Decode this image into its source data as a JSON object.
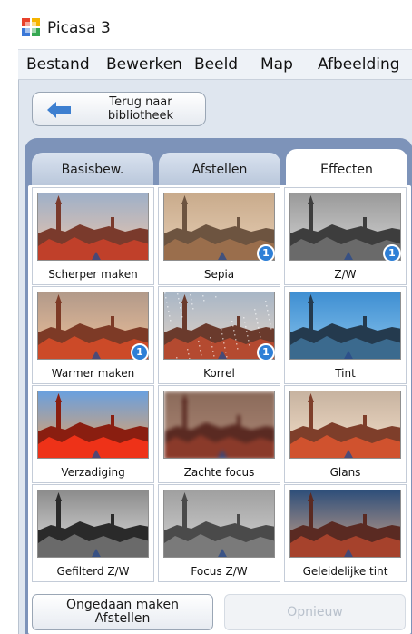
{
  "window": {
    "title": "Picasa 3"
  },
  "menu": [
    {
      "label": "Bestand"
    },
    {
      "label": "Bewerken"
    },
    {
      "label": "Beeld"
    },
    {
      "label": "Map"
    },
    {
      "label": "Afbeelding"
    }
  ],
  "back_button": {
    "line1": "Terug naar",
    "line2": "bibliotheek"
  },
  "tabs": [
    {
      "label": "Basisbew.",
      "active": false
    },
    {
      "label": "Afstellen",
      "active": false
    },
    {
      "label": "Effecten",
      "active": true
    }
  ],
  "effects": [
    {
      "label": "Scherper maken",
      "badge": ""
    },
    {
      "label": "Sepia",
      "badge": "1"
    },
    {
      "label": "Z/W",
      "badge": "1"
    },
    {
      "label": "Warmer maken",
      "badge": "1"
    },
    {
      "label": "Korrel",
      "badge": "1"
    },
    {
      "label": "Tint",
      "badge": ""
    },
    {
      "label": "Verzadiging",
      "badge": ""
    },
    {
      "label": "Zachte focus",
      "badge": ""
    },
    {
      "label": "Glans",
      "badge": ""
    },
    {
      "label": "Gefilterd Z/W",
      "badge": ""
    },
    {
      "label": "Focus Z/W",
      "badge": ""
    },
    {
      "label": "Geleidelijke tint",
      "badge": ""
    }
  ],
  "undo_button": {
    "line1": "Ongedaan maken",
    "line2": "Afstellen"
  },
  "redo_button": {
    "label": "Opnieuw",
    "enabled": false
  },
  "colors": {
    "accent": "#2e7fd6",
    "tab_band": "#7d93b9",
    "panel": "#dfe6ef"
  }
}
